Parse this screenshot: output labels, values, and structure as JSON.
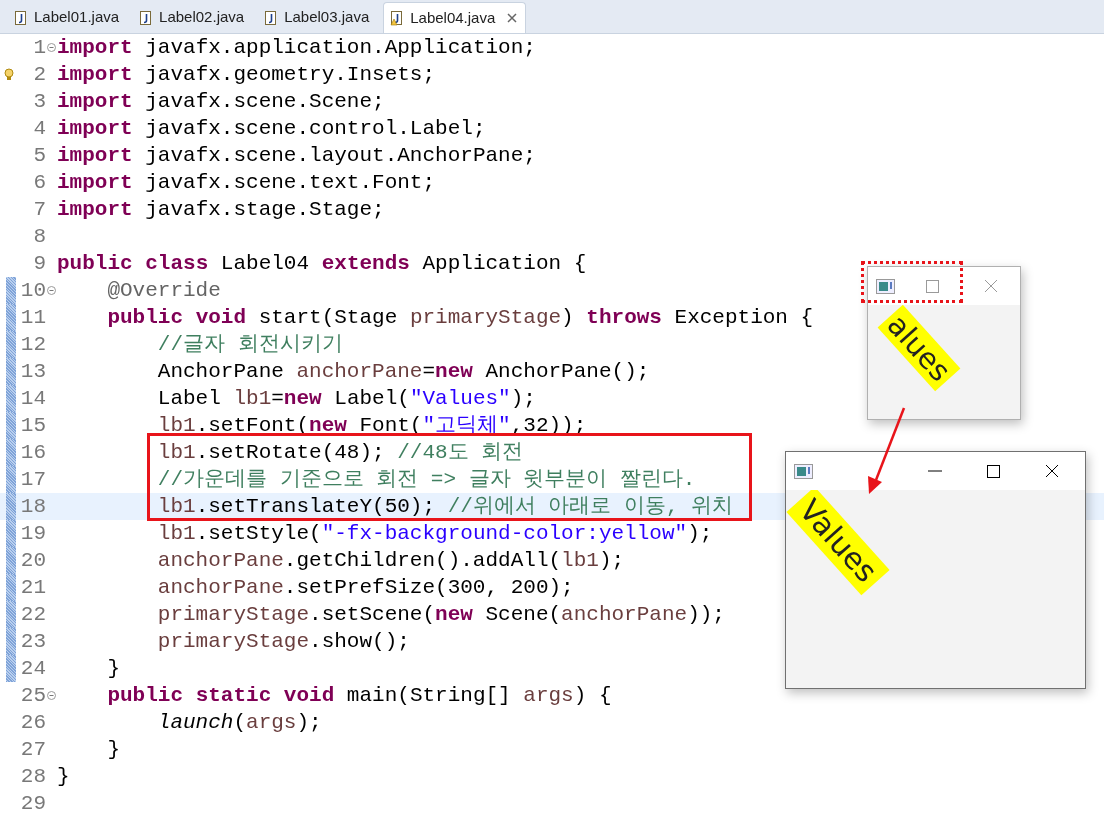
{
  "tabs": [
    {
      "label": "Label01.java",
      "selected": false,
      "warning": false
    },
    {
      "label": "Label02.java",
      "selected": false,
      "warning": false
    },
    {
      "label": "Label03.java",
      "selected": false,
      "warning": false
    },
    {
      "label": "Label04.java",
      "selected": true,
      "warning": true
    }
  ],
  "editor": {
    "lines": [
      {
        "number": "1",
        "fold": true,
        "marker": false,
        "changed": false,
        "current": false,
        "tokens": [
          {
            "kind": "keyword",
            "text": "import"
          },
          {
            "kind": "plain",
            "text": " javafx.application.Application;"
          }
        ]
      },
      {
        "number": "2",
        "fold": false,
        "marker": true,
        "changed": false,
        "current": false,
        "tokens": [
          {
            "kind": "keyword",
            "text": "import"
          },
          {
            "kind": "plain",
            "text": " javafx.geometry.Insets;"
          }
        ]
      },
      {
        "number": "3",
        "fold": false,
        "marker": false,
        "changed": false,
        "current": false,
        "tokens": [
          {
            "kind": "keyword",
            "text": "import"
          },
          {
            "kind": "plain",
            "text": " javafx.scene.Scene;"
          }
        ]
      },
      {
        "number": "4",
        "fold": false,
        "marker": false,
        "changed": false,
        "current": false,
        "tokens": [
          {
            "kind": "keyword",
            "text": "import"
          },
          {
            "kind": "plain",
            "text": " javafx.scene.control.Label;"
          }
        ]
      },
      {
        "number": "5",
        "fold": false,
        "marker": false,
        "changed": false,
        "current": false,
        "tokens": [
          {
            "kind": "keyword",
            "text": "import"
          },
          {
            "kind": "plain",
            "text": " javafx.scene.layout.AnchorPane;"
          }
        ]
      },
      {
        "number": "6",
        "fold": false,
        "marker": false,
        "changed": false,
        "current": false,
        "tokens": [
          {
            "kind": "keyword",
            "text": "import"
          },
          {
            "kind": "plain",
            "text": " javafx.scene.text.Font;"
          }
        ]
      },
      {
        "number": "7",
        "fold": false,
        "marker": false,
        "changed": false,
        "current": false,
        "tokens": [
          {
            "kind": "keyword",
            "text": "import"
          },
          {
            "kind": "plain",
            "text": " javafx.stage.Stage;"
          }
        ]
      },
      {
        "number": "8",
        "fold": false,
        "marker": false,
        "changed": false,
        "current": false
      },
      {
        "number": "9",
        "fold": false,
        "marker": false,
        "changed": false,
        "current": false,
        "tokens": [
          {
            "kind": "keyword",
            "text": "public"
          },
          {
            "kind": "keyword",
            "text": " class"
          },
          {
            "kind": "plain",
            "text": " Label04 "
          },
          {
            "kind": "keyword",
            "text": "extends"
          },
          {
            "kind": "plain",
            "text": " Application {"
          }
        ]
      },
      {
        "number": "10",
        "fold": true,
        "marker": false,
        "changed": true,
        "current": false,
        "tokens": [
          {
            "kind": "annotation",
            "text": "    @Override"
          }
        ]
      },
      {
        "number": "11",
        "fold": false,
        "marker": false,
        "changed": true,
        "current": false,
        "tokens": [
          {
            "kind": "keyword",
            "text": "    public"
          },
          {
            "kind": "keyword",
            "text": " void"
          },
          {
            "kind": "plain",
            "text": " start(Stage "
          },
          {
            "kind": "variable",
            "text": "primaryStage"
          },
          {
            "kind": "plain",
            "text": ") "
          },
          {
            "kind": "keyword",
            "text": "throws"
          },
          {
            "kind": "plain",
            "text": " Exception {"
          }
        ]
      },
      {
        "number": "12",
        "fold": false,
        "marker": false,
        "changed": true,
        "current": false,
        "tokens": [
          {
            "kind": "comment",
            "text": "        //글자 회전시키기"
          }
        ]
      },
      {
        "number": "13",
        "fold": false,
        "marker": false,
        "changed": true,
        "current": false,
        "tokens": [
          {
            "kind": "plain",
            "text": "        AnchorPane "
          },
          {
            "kind": "variable",
            "text": "anchorPane"
          },
          {
            "kind": "plain",
            "text": "="
          },
          {
            "kind": "keyword",
            "text": "new"
          },
          {
            "kind": "plain",
            "text": " AnchorPane();"
          }
        ]
      },
      {
        "number": "14",
        "fold": false,
        "marker": false,
        "changed": true,
        "current": false,
        "tokens": [
          {
            "kind": "plain",
            "text": "        Label "
          },
          {
            "kind": "variable",
            "text": "lb1"
          },
          {
            "kind": "plain",
            "text": "="
          },
          {
            "kind": "keyword",
            "text": "new"
          },
          {
            "kind": "plain",
            "text": " Label("
          },
          {
            "kind": "string",
            "text": "\"Values\""
          },
          {
            "kind": "plain",
            "text": ");"
          }
        ]
      },
      {
        "number": "15",
        "fold": false,
        "marker": false,
        "changed": true,
        "current": false,
        "tokens": [
          {
            "kind": "variable",
            "text": "        lb1"
          },
          {
            "kind": "plain",
            "text": ".setFont("
          },
          {
            "kind": "keyword",
            "text": "new"
          },
          {
            "kind": "plain",
            "text": " Font("
          },
          {
            "kind": "string",
            "text": "\"고딕체\""
          },
          {
            "kind": "plain",
            "text": ",32));"
          }
        ]
      },
      {
        "number": "16",
        "fold": false,
        "marker": false,
        "changed": true,
        "current": false,
        "tokens": [
          {
            "kind": "variable",
            "text": "        lb1"
          },
          {
            "kind": "plain",
            "text": ".setRotate(48); "
          },
          {
            "kind": "comment",
            "text": "//48도 회전"
          }
        ]
      },
      {
        "number": "17",
        "fold": false,
        "marker": false,
        "changed": true,
        "current": false,
        "tokens": [
          {
            "kind": "comment",
            "text": "        //가운데를 기준으로 회전 => 글자 윗부분이 짤린다."
          }
        ]
      },
      {
        "number": "18",
        "fold": false,
        "marker": false,
        "changed": true,
        "current": true,
        "tokens": [
          {
            "kind": "variable",
            "text": "        lb1"
          },
          {
            "kind": "plain",
            "text": ".setTranslateY(50); "
          },
          {
            "kind": "comment",
            "text": "//위에서 아래로 이동, 위치"
          }
        ]
      },
      {
        "number": "19",
        "fold": false,
        "marker": false,
        "changed": true,
        "current": false,
        "tokens": [
          {
            "kind": "variable",
            "text": "        lb1"
          },
          {
            "kind": "plain",
            "text": ".setStyle("
          },
          {
            "kind": "string",
            "text": "\"-fx-background-color:yellow\""
          },
          {
            "kind": "plain",
            "text": ");"
          }
        ]
      },
      {
        "number": "20",
        "fold": false,
        "marker": false,
        "changed": true,
        "current": false,
        "tokens": [
          {
            "kind": "variable",
            "text": "        anchorPane"
          },
          {
            "kind": "plain",
            "text": ".getChildren().addAll("
          },
          {
            "kind": "variable",
            "text": "lb1"
          },
          {
            "kind": "plain",
            "text": ");"
          }
        ]
      },
      {
        "number": "21",
        "fold": false,
        "marker": false,
        "changed": true,
        "current": false,
        "tokens": [
          {
            "kind": "variable",
            "text": "        anchorPane"
          },
          {
            "kind": "plain",
            "text": ".setPrefSize(300, 200);"
          }
        ]
      },
      {
        "number": "22",
        "fold": false,
        "marker": false,
        "changed": true,
        "current": false,
        "tokens": [
          {
            "kind": "variable",
            "text": "        primaryStage"
          },
          {
            "kind": "plain",
            "text": ".setScene("
          },
          {
            "kind": "keyword",
            "text": "new"
          },
          {
            "kind": "plain",
            "text": " Scene("
          },
          {
            "kind": "variable",
            "text": "anchorPane"
          },
          {
            "kind": "plain",
            "text": "));"
          }
        ]
      },
      {
        "number": "23",
        "fold": false,
        "marker": false,
        "changed": true,
        "current": false,
        "tokens": [
          {
            "kind": "variable",
            "text": "        primaryStage"
          },
          {
            "kind": "plain",
            "text": ".show();"
          }
        ]
      },
      {
        "number": "24",
        "fold": false,
        "marker": false,
        "changed": true,
        "current": false,
        "tokens": [
          {
            "kind": "plain",
            "text": "    }"
          }
        ]
      },
      {
        "number": "25",
        "fold": true,
        "marker": false,
        "changed": false,
        "current": false,
        "tokens": [
          {
            "kind": "keyword",
            "text": "    public"
          },
          {
            "kind": "keyword",
            "text": " static"
          },
          {
            "kind": "keyword",
            "text": " void"
          },
          {
            "kind": "plain",
            "text": " main(String[] "
          },
          {
            "kind": "variable",
            "text": "args"
          },
          {
            "kind": "plain",
            "text": ") {"
          }
        ]
      },
      {
        "number": "26",
        "fold": false,
        "marker": false,
        "changed": false,
        "current": false,
        "tokens": [
          {
            "kind": "static",
            "text": "        launch"
          },
          {
            "kind": "plain",
            "text": "("
          },
          {
            "kind": "variable",
            "text": "args"
          },
          {
            "kind": "plain",
            "text": ");"
          }
        ]
      },
      {
        "number": "27",
        "fold": false,
        "marker": false,
        "changed": false,
        "current": false,
        "tokens": [
          {
            "kind": "plain",
            "text": "    }"
          }
        ]
      },
      {
        "number": "28",
        "fold": false,
        "marker": false,
        "changed": false,
        "current": false,
        "tokens": [
          {
            "kind": "plain",
            "text": "}"
          }
        ]
      },
      {
        "number": "29",
        "fold": false,
        "marker": false,
        "changed": false,
        "current": false
      }
    ]
  },
  "windows": [
    {
      "kind": "small",
      "label": "alues",
      "controls": [
        {
          "kind": "maximize"
        },
        {
          "kind": "close"
        }
      ],
      "inactive": true
    },
    {
      "kind": "large",
      "label": "Values",
      "controls": [
        {
          "kind": "minimize"
        },
        {
          "kind": "maximize"
        },
        {
          "kind": "close"
        }
      ],
      "inactive": false
    }
  ],
  "annotations": [
    {
      "kind": "box"
    },
    {
      "kind": "dotted-box"
    },
    {
      "kind": "arrow"
    }
  ]
}
